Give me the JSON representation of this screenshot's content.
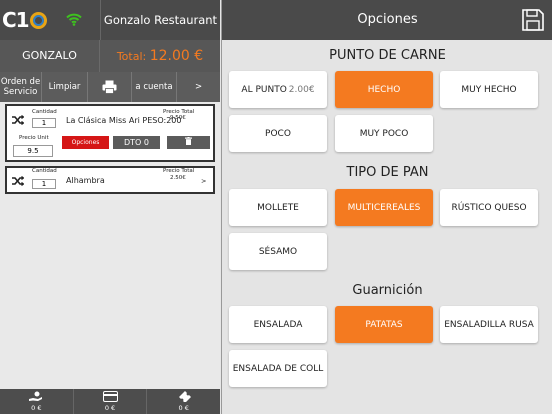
{
  "header": {
    "logo": "C1",
    "restaurant": "Gonzalo Restaurant",
    "user": "GONZALO",
    "total_label": "Total:",
    "total_amount": "12.00 €"
  },
  "actions": [
    {
      "label": "Orden de Servicio"
    },
    {
      "label": "Limpiar"
    },
    {
      "label": ""
    },
    {
      "label": "a cuenta"
    },
    {
      "label": ">"
    }
  ],
  "order_items": [
    {
      "qty_label": "Cantidad",
      "qty": "1",
      "name": "La Clásica Miss Ari PESO:200",
      "price_total_label": "Precio Total",
      "price_total": "9.50€",
      "unit_label": "Precio Unit",
      "unit_price": "9.5",
      "options_label": "Opciones",
      "discount_label": "DTO 0"
    },
    {
      "qty_label": "Cantidad",
      "qty": "1",
      "name": "Alhambra",
      "price_total_label": "Precio Total",
      "price_total": "2.50€",
      "chevron": ">"
    }
  ],
  "bottom": [
    "0 €",
    "0 €",
    "0 €"
  ],
  "panel": {
    "title": "Opciones",
    "sections": [
      {
        "title": "PUNTO DE CARNE",
        "options": [
          {
            "label": "AL PUNTO",
            "price": "2.00€",
            "selected": false
          },
          {
            "label": "HECHO",
            "selected": true
          },
          {
            "label": "MUY HECHO",
            "selected": false
          },
          {
            "label": "POCO",
            "selected": false
          },
          {
            "label": "MUY POCO",
            "selected": false
          }
        ]
      },
      {
        "title": "TIPO DE PAN",
        "options": [
          {
            "label": "MOLLETE",
            "selected": false
          },
          {
            "label": "MULTICEREALES",
            "selected": true
          },
          {
            "label": "RÚSTICO QUESO",
            "selected": false
          },
          {
            "label": "SÉSAMO",
            "selected": false
          }
        ]
      },
      {
        "title": "Guarnición",
        "options": [
          {
            "label": "ENSALADA",
            "selected": false
          },
          {
            "label": "PATATAS",
            "selected": true
          },
          {
            "label": "ENSALADILLA RUSA",
            "selected": false
          },
          {
            "label": "ENSALADA DE COLL",
            "selected": false
          }
        ]
      }
    ]
  },
  "colors": {
    "accent": "#f47a20",
    "danger": "#d51616",
    "dark": "#4a4a4a"
  }
}
